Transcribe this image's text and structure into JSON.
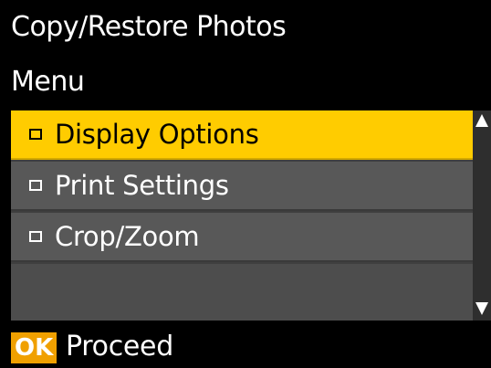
{
  "header": {
    "title": "Copy/Restore Photos",
    "subtitle": "Menu"
  },
  "menu": {
    "items": [
      {
        "label": "Display Options",
        "selected": true
      },
      {
        "label": "Print Settings",
        "selected": false
      },
      {
        "label": "Crop/Zoom",
        "selected": false
      }
    ]
  },
  "footer": {
    "ok_label": "OK",
    "action_label": "Proceed"
  },
  "colors": {
    "background": "#000000",
    "selected": "#ffcc00",
    "item": "#585858",
    "ok_badge": "#f0a000"
  },
  "icons": {
    "bullet": "square-bullet-icon",
    "scroll_up": "triangle-up-icon",
    "scroll_down": "triangle-down-icon"
  }
}
